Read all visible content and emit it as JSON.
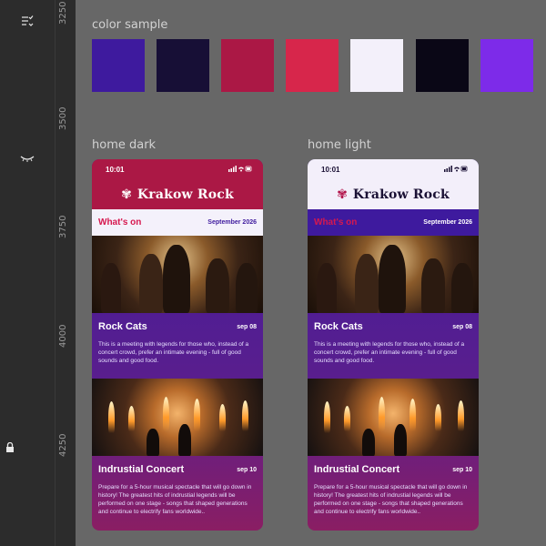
{
  "toolbar": {
    "icons": [
      "list-check-icon",
      "eye-closed-icon",
      "lock-icon"
    ]
  },
  "ruler": {
    "labels": [
      "3250",
      "3500",
      "3750",
      "4000",
      "4250"
    ]
  },
  "canvas": {
    "color_sample_label": "color sample",
    "swatches": [
      "#3e1a9e",
      "#170f36",
      "#ab1845",
      "#d7264b",
      "#f3f0fa",
      "#0a0716",
      "#7d2be9"
    ],
    "home_dark_label": "home dark",
    "home_light_label": "home light"
  },
  "phone": {
    "time": "10:01",
    "brand": "Krakow Rock",
    "whats_on": "What's on",
    "month": "September 2026",
    "events": [
      {
        "title": "Rock Cats",
        "date": "sep 08",
        "desc": "This is a meeting with legends for those who, instead of a concert crowd, prefer an intimate evening - full of good sounds and good food."
      },
      {
        "title": "Indrustial Concert",
        "date": "sep 10",
        "desc": "Prepare for a 5-hour musical spectacle that will go down in history! The greatest hits of indrustial legends will be performed on one stage - songs that shaped generations and continue to electrify fans worldwide.."
      }
    ]
  }
}
